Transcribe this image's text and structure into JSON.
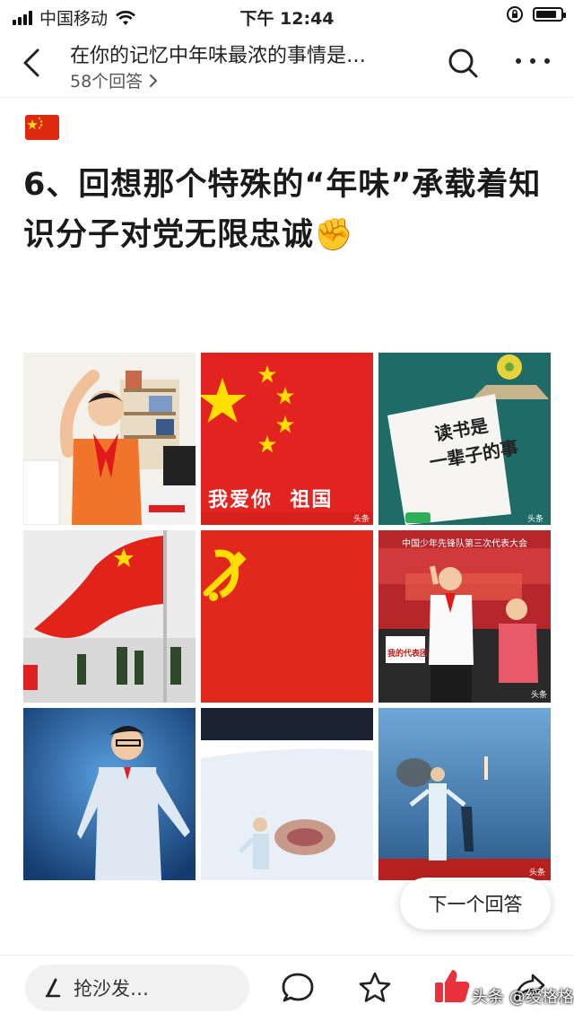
{
  "status_bar": {
    "carrier": "中国移动",
    "time": "下午 12:44",
    "battery_level": 0.85
  },
  "nav": {
    "title": "在你的记忆中年味最浓的事情是…",
    "answer_count": "58个回答",
    "chevron": "›"
  },
  "post": {
    "headline": "6、回想那个特殊的“年味”承载着知识分子对党无限忠诚✊"
  },
  "images": {
    "t1_caption": "",
    "t2_caption": "我爱你  祖国",
    "t2_small": "头条",
    "t3_book_title_1": "读书是",
    "t3_book_title_2": "一辈子的事",
    "t3_small": "头条",
    "t6_banner": "中国少年先锋队第三次代表大会",
    "t6_sign": "我的代表团",
    "t6_small": "头条",
    "t9_small": "头条"
  },
  "next_answer": {
    "label": "下一个回答"
  },
  "bottom_bar": {
    "comment_placeholder": "抢沙发…",
    "watermark": "头条 @绶格格"
  },
  "colors": {
    "flag_red": "#de2910",
    "star_yellow": "#ffde00",
    "like_red": "#e8323c"
  },
  "icons": [
    "signal-icon",
    "wifi-icon",
    "lock-rotation-icon",
    "battery-icon",
    "back-icon",
    "chevron-right-icon",
    "search-icon",
    "more-icon",
    "pen-icon",
    "comment-icon",
    "star-icon",
    "like-icon",
    "share-icon",
    "raised-fist-emoji",
    "china-flag-emoji"
  ]
}
